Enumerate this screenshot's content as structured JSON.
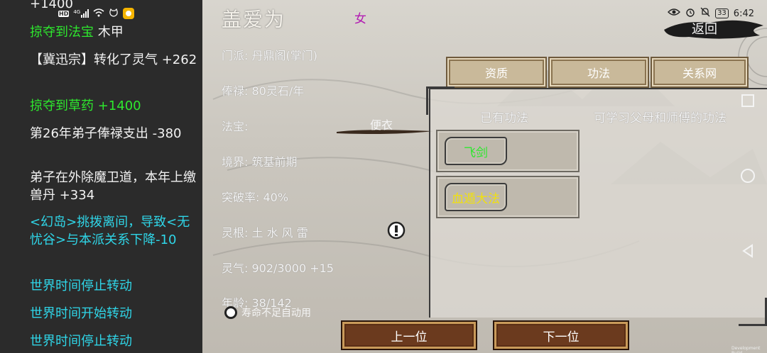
{
  "status_bar": {
    "left_icons": [
      "hd-icon",
      "signal-4g-icon",
      "wifi-icon",
      "cat-app-icon",
      "notification-app-icon"
    ],
    "network_label": "4G",
    "hd_label": "HD",
    "battery": "33",
    "time": "6:42",
    "right_icons": [
      "eye-icon",
      "alarm-icon",
      "mute-icon",
      "battery-icon"
    ]
  },
  "log": {
    "lines": [
      {
        "text": "+1400",
        "color": "white"
      },
      {
        "text": "掠夺到法宝",
        "color": "green",
        "suffix": " 木甲"
      },
      {
        "text": "【冀迅宗】转化了灵气 +262",
        "color": "white"
      },
      {
        "text": "掠夺到草药 +1400",
        "color": "green"
      },
      {
        "text": "第26年弟子俸禄支出 -380",
        "color": "white"
      },
      {
        "text": "弟子在外除魔卫道，本年上缴兽丹 +334",
        "color": "white"
      },
      {
        "text": "<幻岛>挑拨离间，导致<无忧谷>与本派关系下降-10",
        "color": "cyan"
      },
      {
        "text": "世界时间停止转动",
        "color": "cyan"
      },
      {
        "text": "世界时间开始转动",
        "color": "cyan"
      },
      {
        "text": "世界时间停止转动",
        "color": "cyan"
      }
    ]
  },
  "character": {
    "name": "盖爱为",
    "gender": "女",
    "sect": "门派: 丹鼎阁(掌门)",
    "salary": "俸禄: 80灵石/年",
    "treasure_label": "法宝:",
    "treasure_value": "便衣",
    "realm": "境界: 筑基前期",
    "breakthrough": "突破率: 40%",
    "root": "灵根: 土 水 风 雷",
    "qi": "灵气: 902/3000 +15",
    "age": "年龄: 38/142",
    "auto_use_label": "寿命不足自动用"
  },
  "header": {
    "back_label": "返回"
  },
  "tabs": [
    {
      "label": "资质"
    },
    {
      "label": "功法"
    },
    {
      "label": "关系网"
    }
  ],
  "skills_panel": {
    "owned_title": "已有功法",
    "learnable_title": "可学习父母和师傅的功法",
    "owned": [
      {
        "name": "飞剑",
        "color": "#2ee82e"
      },
      {
        "name": "血遁大法",
        "color": "#f0e010"
      }
    ]
  },
  "nav": {
    "prev_label": "上一位",
    "next_label": "下一位"
  },
  "system_nav": {
    "icons": [
      "square-recent-icon",
      "circle-home-icon",
      "triangle-back-icon"
    ]
  },
  "watermark": "Development Build"
}
